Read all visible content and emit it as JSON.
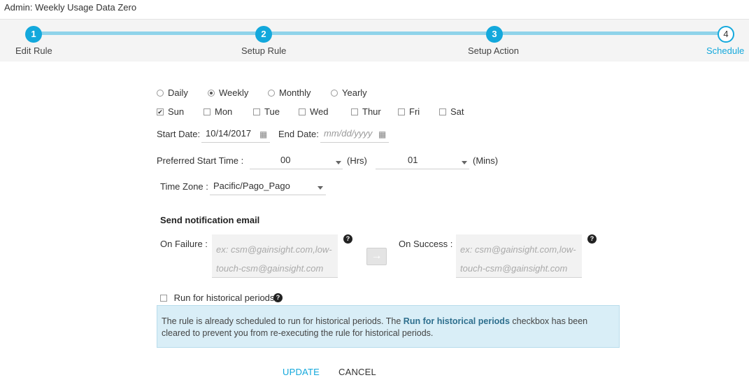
{
  "header": {
    "title": "Admin: Weekly Usage Data Zero"
  },
  "steps": [
    {
      "number": "1",
      "label": "Edit Rule"
    },
    {
      "number": "2",
      "label": "Setup Rule"
    },
    {
      "number": "3",
      "label": "Setup Action"
    },
    {
      "number": "4",
      "label": "Schedule"
    }
  ],
  "frequency": {
    "options": [
      "Daily",
      "Weekly",
      "Monthly",
      "Yearly"
    ],
    "selected": "Weekly"
  },
  "days": {
    "options": [
      "Sun",
      "Mon",
      "Tue",
      "Wed",
      "Thur",
      "Fri",
      "Sat"
    ],
    "checked": [
      "Sun"
    ]
  },
  "dates": {
    "start_label": "Start Date:",
    "start_value": "10/14/2017",
    "end_label": "End Date:",
    "end_placeholder": "mm/dd/yyyy"
  },
  "start_time": {
    "label": "Preferred Start Time :",
    "hours": "00",
    "hours_unit": "(Hrs)",
    "mins": "01",
    "mins_unit": "(Mins)"
  },
  "timezone": {
    "label": "Time Zone :",
    "value": "Pacific/Pago_Pago"
  },
  "notification": {
    "heading": "Send notification email",
    "failure_label": "On Failure :",
    "failure_placeholder_line1": "ex: csm@gainsight.com,low-",
    "failure_placeholder_line2": "touch-csm@gainsight.com",
    "success_label": "On Success :",
    "success_placeholder_line1": "ex: csm@gainsight.com,low-",
    "success_placeholder_line2": "touch-csm@gainsight.com"
  },
  "historical": {
    "label": "Run for historical periods",
    "info_before": "The rule is already scheduled to run for historical periods. The ",
    "info_bold": "Run for historical periods",
    "info_after": " checkbox has been cleared to prevent you from re-executing the rule for historical periods."
  },
  "actions": {
    "update": "UPDATE",
    "cancel": "CANCEL"
  },
  "colors": {
    "accent": "#13a8dc",
    "info_bg": "#d9eef7"
  },
  "icons": {
    "help": "question-circle-icon",
    "calendar": "calendar-icon",
    "arrow": "arrow-right-icon"
  }
}
